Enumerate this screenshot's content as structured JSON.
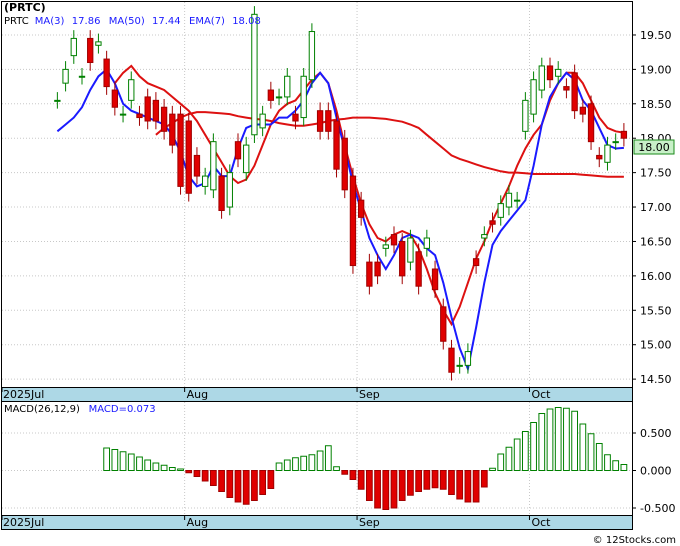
{
  "ticker": "(PRTC)",
  "watermark": "© 12Stocks.com",
  "price_panel": {
    "legend": [
      {
        "label": "PRTC",
        "color": "#000000"
      },
      {
        "label": "MA(3)",
        "color": "#1a1aff"
      },
      {
        "label": "17.86",
        "color": "#1a1aff"
      },
      {
        "label": "MA(50)",
        "color": "#1a1aff"
      },
      {
        "label": "17.44",
        "color": "#1a1aff"
      },
      {
        "label": "EMA(7)",
        "color": "#1a1aff"
      },
      {
        "label": "18.08",
        "color": "#1a1aff"
      }
    ],
    "last_price_tag": "18.00",
    "ylim": [
      14.4,
      19.95
    ],
    "ticks": [
      "14.50",
      "15.00",
      "15.50",
      "16.00",
      "16.50",
      "17.00",
      "17.50",
      "18.00",
      "18.50",
      "19.00",
      "19.50"
    ]
  },
  "macd_panel": {
    "legend": [
      {
        "label": "MACD(26,12,9)",
        "color": "#000000"
      },
      {
        "label": "MACD=0.073",
        "color": "#1a1aff"
      }
    ],
    "ylim": [
      -0.58,
      0.9
    ],
    "ticks": [
      "-0.500",
      "0.000",
      "0.500"
    ]
  },
  "x_axis": [
    "2025Jul",
    "Aug",
    "Sep",
    "Oct"
  ],
  "colors": {
    "up": "#008000",
    "down": "#e00000",
    "ma_fast": "#1a1aff",
    "ma_slow": "#dd1111",
    "ema": "#dd1111",
    "axis_band": "#add8e6",
    "grid": "#c8c8c8",
    "tag_bg": "#c8f0c8"
  },
  "chart_data": {
    "type": "candlestick",
    "dates": [
      "2025-07-01",
      "2025-07-02",
      "2025-07-03",
      "2025-07-07",
      "2025-07-08",
      "2025-07-09",
      "2025-07-10",
      "2025-07-11",
      "2025-07-14",
      "2025-07-15",
      "2025-07-16",
      "2025-07-17",
      "2025-07-18",
      "2025-07-21",
      "2025-07-22",
      "2025-07-23",
      "2025-07-24",
      "2025-07-25",
      "2025-07-28",
      "2025-07-29",
      "2025-07-30",
      "2025-07-31",
      "2025-08-01",
      "2025-08-04",
      "2025-08-05",
      "2025-08-06",
      "2025-08-07",
      "2025-08-08",
      "2025-08-11",
      "2025-08-12",
      "2025-08-13",
      "2025-08-14",
      "2025-08-15",
      "2025-08-18",
      "2025-08-19",
      "2025-08-20",
      "2025-08-21",
      "2025-08-22",
      "2025-08-25",
      "2025-08-26",
      "2025-08-27",
      "2025-08-28",
      "2025-08-29",
      "2025-09-02",
      "2025-09-03",
      "2025-09-04",
      "2025-09-05",
      "2025-09-08",
      "2025-09-09",
      "2025-09-10",
      "2025-09-11",
      "2025-09-12",
      "2025-09-15",
      "2025-09-16",
      "2025-09-17",
      "2025-09-18",
      "2025-09-19",
      "2025-09-22",
      "2025-09-23",
      "2025-09-24",
      "2025-09-25",
      "2025-09-26",
      "2025-09-29",
      "2025-09-30",
      "2025-10-01",
      "2025-10-02",
      "2025-10-03",
      "2025-10-06",
      "2025-10-07",
      "2025-10-08",
      "2025-10-09",
      "2025-10-10",
      "2025-10-13",
      "2025-10-14",
      "2025-10-15",
      "2025-10-16"
    ],
    "open": [
      18.55,
      18.8,
      19.2,
      18.9,
      19.45,
      19.35,
      19.15,
      18.7,
      18.35,
      18.55,
      18.35,
      18.6,
      18.55,
      18.45,
      18.35,
      18.35,
      18.25,
      17.75,
      17.3,
      17.25,
      17.45,
      17.0,
      17.95,
      17.5,
      18.05,
      18.15,
      18.7,
      18.6,
      18.6,
      18.35,
      18.3,
      18.85,
      18.4,
      18.4,
      18.25,
      18.0,
      17.45,
      17.1,
      16.2,
      16.2,
      16.4,
      16.6,
      16.5,
      16.2,
      16.35,
      16.4,
      16.1,
      15.55,
      14.95,
      14.7,
      14.7,
      16.25,
      16.55,
      16.8,
      16.85,
      17.0,
      17.1,
      18.1,
      18.35,
      18.7,
      19.05,
      18.9,
      18.75,
      18.95,
      18.45,
      18.5,
      17.75,
      17.65,
      17.95,
      18.1
    ],
    "close": [
      18.55,
      19.0,
      19.45,
      18.9,
      19.1,
      19.4,
      18.75,
      18.45,
      18.35,
      18.85,
      18.3,
      18.25,
      18.25,
      18.1,
      17.9,
      17.3,
      17.2,
      17.45,
      17.45,
      17.95,
      16.95,
      17.5,
      17.7,
      17.9,
      19.8,
      18.35,
      18.55,
      18.6,
      18.9,
      18.25,
      18.9,
      19.55,
      18.1,
      18.1,
      17.55,
      17.25,
      16.15,
      16.85,
      15.85,
      16.0,
      16.45,
      16.45,
      16.0,
      16.55,
      15.85,
      16.55,
      15.8,
      15.05,
      14.6,
      14.7,
      14.9,
      16.15,
      16.6,
      16.75,
      17.05,
      17.2,
      17.1,
      18.55,
      18.85,
      19.05,
      18.85,
      19.0,
      18.7,
      18.4,
      18.35,
      17.95,
      17.7,
      17.9,
      17.95,
      18.0
    ],
    "ma3": [
      18.1,
      18.2,
      18.3,
      18.45,
      18.7,
      18.9,
      19.0,
      18.8,
      18.5,
      18.4,
      18.35,
      18.3,
      18.25,
      18.2,
      18.05,
      17.8,
      17.45,
      17.3,
      17.35,
      17.6,
      17.45,
      17.45,
      17.85,
      18.15,
      18.2,
      18.2,
      18.2,
      18.3,
      18.3,
      18.4,
      18.55,
      18.8,
      18.95,
      18.8,
      18.3,
      17.85,
      17.35,
      16.95,
      16.55,
      16.3,
      16.1,
      16.3,
      16.55,
      16.6,
      16.55,
      16.4,
      16.3,
      15.9,
      15.4,
      14.95,
      14.65,
      15.25,
      15.9,
      16.45,
      16.65,
      16.8,
      16.95,
      17.1,
      17.6,
      18.2,
      18.6,
      18.8,
      18.95,
      18.85,
      18.55,
      18.4,
      18.15,
      17.9,
      17.85,
      17.86
    ],
    "ma50": [
      18.05,
      18.15,
      18.22,
      18.3,
      18.35,
      18.38,
      18.38,
      18.37,
      18.36,
      18.35,
      18.32,
      18.3,
      18.28,
      18.27,
      18.25,
      18.22,
      18.2,
      18.18,
      18.18,
      18.2,
      18.22,
      18.25,
      18.27,
      18.28,
      18.3,
      18.3,
      18.3,
      18.29,
      18.28,
      18.26,
      18.24,
      18.2,
      18.15,
      18.05,
      17.95,
      17.85,
      17.75,
      17.7,
      17.66,
      17.62,
      17.58,
      17.55,
      17.52,
      17.5,
      17.5,
      17.49,
      17.48,
      17.48,
      17.48,
      17.48,
      17.48,
      17.48,
      17.47,
      17.46,
      17.45,
      17.44,
      17.44,
      17.44
    ],
    "ema7": [
      18.8,
      18.95,
      19.05,
      18.9,
      18.8,
      18.75,
      18.7,
      18.6,
      18.5,
      18.4,
      18.25,
      18.05,
      17.85,
      17.65,
      17.45,
      17.35,
      17.4,
      17.6,
      17.9,
      18.2,
      18.4,
      18.5,
      18.55,
      18.7,
      18.85,
      18.95,
      18.8,
      18.4,
      17.9,
      17.45,
      17.05,
      16.75,
      16.55,
      16.5,
      16.6,
      16.65,
      16.6,
      16.4,
      16.1,
      15.75,
      15.5,
      15.3,
      15.55,
      15.9,
      16.25,
      16.5,
      16.8,
      17.05,
      17.3,
      17.6,
      17.85,
      18.05,
      18.2,
      18.55,
      18.8,
      18.95,
      18.95,
      18.8,
      18.55,
      18.3,
      18.15,
      18.1,
      18.08
    ],
    "macd_hist": [
      0.3,
      0.28,
      0.25,
      0.22,
      0.18,
      0.14,
      0.1,
      0.07,
      0.04,
      0.02,
      -0.03,
      -0.08,
      -0.14,
      -0.2,
      -0.28,
      -0.36,
      -0.42,
      -0.45,
      -0.4,
      -0.32,
      -0.24,
      0.1,
      0.14,
      0.17,
      0.19,
      0.21,
      0.26,
      0.33,
      0.05,
      -0.05,
      -0.12,
      -0.25,
      -0.4,
      -0.5,
      -0.52,
      -0.5,
      -0.4,
      -0.33,
      -0.28,
      -0.25,
      -0.23,
      -0.25,
      -0.32,
      -0.38,
      -0.42,
      -0.42,
      -0.22,
      0.03,
      0.22,
      0.31,
      0.42,
      0.52,
      0.64,
      0.76,
      0.82,
      0.84,
      0.83,
      0.79,
      0.62,
      0.49,
      0.36,
      0.21,
      0.13,
      0.08
    ],
    "volume_ticks": []
  }
}
